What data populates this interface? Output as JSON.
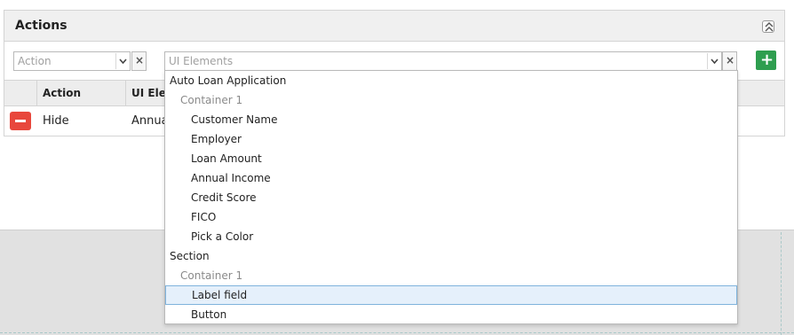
{
  "panel": {
    "title": "Actions"
  },
  "toolbar": {
    "action_placeholder": "Action",
    "ui_elements_placeholder": "UI Elements",
    "clear_label": "×",
    "add_label": "+"
  },
  "table": {
    "headers": [
      "Action",
      "UI Elem"
    ],
    "rows": [
      {
        "action": "Hide",
        "ui_element": "Annua"
      }
    ]
  },
  "dropdown": {
    "items": [
      {
        "label": "Auto Loan Application",
        "level": 0
      },
      {
        "label": "Container 1",
        "level": 1
      },
      {
        "label": "Customer Name",
        "level": 2
      },
      {
        "label": "Employer",
        "level": 2
      },
      {
        "label": "Loan Amount",
        "level": 2
      },
      {
        "label": "Annual Income",
        "level": 2
      },
      {
        "label": "Credit Score",
        "level": 2
      },
      {
        "label": "FICO",
        "level": 2
      },
      {
        "label": "Pick a Color",
        "level": 2
      },
      {
        "label": "Section",
        "level": 0
      },
      {
        "label": "Container 1",
        "level": 1
      },
      {
        "label": "Label field",
        "level": 2,
        "selected": true
      },
      {
        "label": "Button",
        "level": 2
      }
    ]
  },
  "colors": {
    "add_button": "#2e9e4f",
    "remove_button": "#e8473c",
    "selected_item_bg": "#e5f0fb",
    "selected_item_border": "#7fb3dc"
  }
}
